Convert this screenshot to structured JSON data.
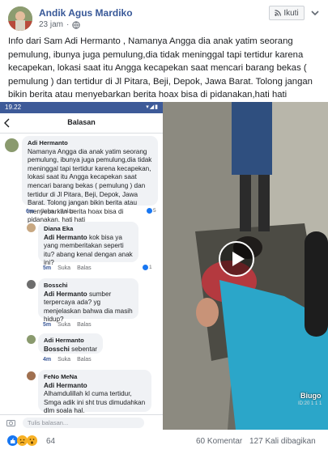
{
  "post": {
    "author": "Andik Agus Mardiko",
    "time": "23 jam",
    "follow_label": "Ikuti",
    "text": "Info dari Sam Adi Hermanto , Namanya Angga dia anak yatim seorang pemulung, ibunya juga pemulung,dia tidak meninggal tapi tertidur karena kecapekan, lokasi saat itu Angga kecapekan saat mencari barang bekas ( pemulung ) dan tertidur di Jl Pitara, Beji, Depok, Jawa Barat. Tolong jangan bikin berita atau menyebarkan berita hoax bisa di pidanakan,hati hati"
  },
  "phone": {
    "status_time": "19.22",
    "status_icons": "▾◢▮",
    "title": "Balasan",
    "comments": [
      {
        "name": "Adi Hermanto",
        "text": "Namanya Angga dia anak yatim seorang pemulung, ibunya juga pemulung,dia tidak meninggal tapi tertidur karena kecapekan, lokasi saat itu Angga kecapekan saat mencari barang bekas ( pemulung ) dan tertidur di Jl Pitara, Beji, Depok, Jawa Barat. Tolong jangan bikin berita atau menyebarkan berita hoax bisa di pidanakan, hati hati",
        "text_visible": "Namanya Angga dia anak yatim seorang pemulung, ibunya juga pemulung,dia tidak meninggal tapi tertidur karena kecapekan, lokasi saat itu Angga kecapekan saat mencari barang bekas ( pemulung ) dan tertidur di Jl Pitara, Beji, Depok, Jawa Barat. Tolong jangan bikin berita atau menyebarkan berita hoax bisa di pidanakan, hati hati",
        "time": "6m",
        "like": "Suka",
        "reply": "Balas",
        "reactions": "5"
      },
      {
        "name": "Diana Eka",
        "mention": "Adi Hermanto",
        "text": "kok bisa ya yang memberitakan seperti itu? abang kenal dengan anak ini?",
        "time": "5m",
        "like": "Suka",
        "reply": "Balas",
        "reactions": "1"
      },
      {
        "name": "Bosschi",
        "mention": "Adi Hermanto",
        "text": "sumber terpercaya ada? yg menjelaskan bahwa dia masih hidup?",
        "time": "5m",
        "like": "Suka",
        "reply": "Balas"
      },
      {
        "name": "Adi Hermanto",
        "mention": "Bosschi",
        "text": "sebentar",
        "time": "4m",
        "like": "Suka",
        "reply": "Balas"
      },
      {
        "name": "FeNo MeNa",
        "mention": "Adi Hermanto",
        "text": "Alhamdulillah kl cuma tertidur, Smga adik ini sht trus dimudahkan dlm soala hal."
      }
    ],
    "reply_placeholder": "Tulis balasan..."
  },
  "video": {
    "brand": "Biugo",
    "id_text": "ID:20 1 1 1"
  },
  "footer": {
    "reaction_count": "64",
    "comments": "60 Komentar",
    "shares": "127 Kali dibagikan"
  },
  "colors": {
    "link": "#385898",
    "statusbar": "#3d5a98",
    "like_blue": "#1877f2",
    "haha_yellow": "#f7b125"
  }
}
